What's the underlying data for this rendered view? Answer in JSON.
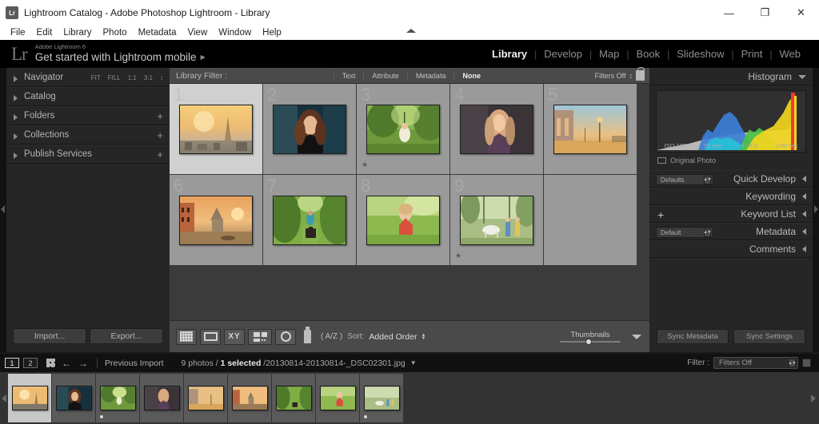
{
  "window": {
    "app_icon": "lightroom-icon",
    "title": "Lightroom Catalog - Adobe Photoshop Lightroom - Library",
    "minimize": "—",
    "maximize": "❐",
    "close": "✕"
  },
  "menubar": {
    "items": [
      "File",
      "Edit",
      "Library",
      "Photo",
      "Metadata",
      "View",
      "Window",
      "Help"
    ]
  },
  "identity": {
    "logo": "Lr",
    "product": "Adobe Lightroom 6",
    "tagline": "Get started with Lightroom mobile",
    "tagline_arrow": "▶"
  },
  "modules": {
    "items": [
      "Library",
      "Develop",
      "Map",
      "Book",
      "Slideshow",
      "Print",
      "Web"
    ],
    "active": "Library",
    "separator": "|"
  },
  "left_panel": {
    "rows": [
      {
        "label": "Navigator",
        "zooms": [
          "FIT",
          "FILL",
          "1:1",
          "3:1"
        ],
        "stepper": "↕"
      },
      {
        "label": "Catalog"
      },
      {
        "label": "Folders",
        "plus": "+"
      },
      {
        "label": "Collections",
        "plus": "+"
      },
      {
        "label": "Publish Services",
        "plus": "+"
      }
    ],
    "import_label": "Import...",
    "export_label": "Export..."
  },
  "library_filter": {
    "label": "Library Filter :",
    "tabs": [
      "Text",
      "Attribute",
      "Metadata",
      "None"
    ],
    "active_tab": "None",
    "filters_state": "Filters Off",
    "stepper": "↕",
    "lock_icon": "lock-icon"
  },
  "grid": {
    "cells": [
      {
        "number": "1",
        "selected": true,
        "star": "",
        "alt": "paris-eiffel-tower-sunset"
      },
      {
        "number": "2",
        "selected": false,
        "star": "",
        "alt": "portrait-woman-dark-hair"
      },
      {
        "number": "3",
        "selected": false,
        "star": "★",
        "alt": "girl-swing-forest"
      },
      {
        "number": "4",
        "selected": false,
        "star": "",
        "alt": "portrait-woman-purple-top"
      },
      {
        "number": "5",
        "selected": false,
        "star": "",
        "alt": "venice-piazza-sunset"
      },
      {
        "number": "6",
        "selected": false,
        "star": "",
        "alt": "venice-canal-sunset"
      },
      {
        "number": "7",
        "selected": false,
        "star": "",
        "alt": "traveler-suitcase-green-path"
      },
      {
        "number": "8",
        "selected": false,
        "star": "",
        "alt": "girl-red-dress-meadow"
      },
      {
        "number": "9",
        "selected": false,
        "star": "★",
        "alt": "children-pony-forest"
      }
    ]
  },
  "toolbar": {
    "view_buttons": [
      "grid-view-icon",
      "loupe-view-icon",
      "compare-view-icon",
      "survey-view-icon",
      "people-view-icon"
    ],
    "spray_icon": "spray-can-icon",
    "sort_az": "( A/Z )",
    "sort_label": "Sort:",
    "sort_value": "Added Order",
    "sort_stepper": "↕",
    "thumbnails_label": "Thumbnails",
    "caret": "caret-down-icon"
  },
  "right_panel": {
    "histogram": {
      "title": "Histogram",
      "caret": "▼",
      "iso": "ISO 100",
      "focal": "70 mm",
      "aperture": "f / 8.0",
      "shutter": "1/60 sec",
      "original_photo": "Original Photo"
    },
    "sections": [
      {
        "label": "Quick Develop",
        "dropdown": "Defaults",
        "caret": "left"
      },
      {
        "label": "Keywording",
        "caret": "left"
      },
      {
        "label": "Keyword List",
        "plus": "+",
        "caret": "left"
      },
      {
        "label": "Metadata",
        "dropdown": "Default",
        "caret": "left"
      },
      {
        "label": "Comments",
        "caret": "left"
      }
    ],
    "sync_metadata": "Sync Metadata",
    "sync_settings": "Sync Settings"
  },
  "filmstrip_status": {
    "page_1": "1",
    "page_2": "2",
    "grid_icon": "grid-icon",
    "back_arrow": "←",
    "forward_arrow": "→",
    "source": "Previous Import",
    "count": "9 photos /",
    "selected": "1 selected",
    "filename": "/20130814-20130814-_DSC02301.jpg",
    "caret": "▼",
    "filter_label": "Filter :",
    "filter_value": "Filters Off",
    "filter_stepper": "↕"
  },
  "filmstrip": {
    "cells": [
      {
        "selected": true,
        "dot": false,
        "alt": "paris-eiffel-tower-sunset"
      },
      {
        "selected": false,
        "dot": false,
        "alt": "portrait-woman-dark-hair"
      },
      {
        "selected": false,
        "dot": true,
        "alt": "girl-swing-forest"
      },
      {
        "selected": false,
        "dot": false,
        "alt": "portrait-woman-purple-top"
      },
      {
        "selected": false,
        "dot": false,
        "alt": "venice-piazza-sunset"
      },
      {
        "selected": false,
        "dot": false,
        "alt": "venice-canal-sunset"
      },
      {
        "selected": false,
        "dot": false,
        "alt": "traveler-suitcase-green-path"
      },
      {
        "selected": false,
        "dot": false,
        "alt": "girl-red-dress-meadow"
      },
      {
        "selected": false,
        "dot": true,
        "alt": "children-pony-forest"
      }
    ]
  },
  "colors": {
    "panel_bg": "#262626",
    "center_bg": "#3b3b3b",
    "toolbar_bg": "#4a4a4a",
    "cell_bg": "#9a9a9a",
    "cell_selected_bg": "#d0d0d0",
    "text_primary": "#c9c9c9",
    "text_muted": "#8c8c8c",
    "titlebar_bg": "#ffffff"
  }
}
